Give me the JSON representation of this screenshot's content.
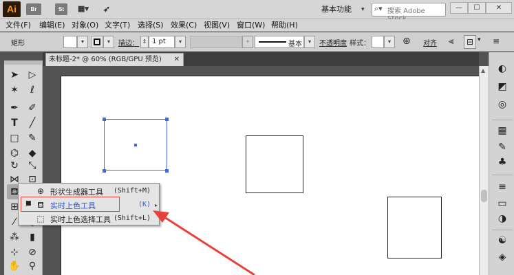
{
  "app": {
    "logo": "Ai",
    "bridge": "Br",
    "stock": "St",
    "workspace": "基本功能",
    "search_placeholder": "搜索 Adobe Stock",
    "minimize": "—",
    "maximize": "☐",
    "close": "✕"
  },
  "menu": [
    "文件(F)",
    "编辑(E)",
    "对象(O)",
    "文字(T)",
    "选择(S)",
    "效果(C)",
    "视图(V)",
    "窗口(W)",
    "帮助(H)"
  ],
  "control": {
    "object_type": "矩形",
    "stroke_label": "描边：",
    "stroke_value": "1 pt",
    "brush_label": "基本",
    "opacity_label": "不透明度",
    "style_label": "样式：",
    "align_label": "对齐"
  },
  "document": {
    "tab_title": "未标题-2* @ 60% (RGB/GPU 预览)",
    "close": "✕"
  },
  "flyout": {
    "items": [
      {
        "mark": "",
        "label": "形状生成器工具",
        "shortcut": "(Shift+M)",
        "icon": "shape-builder-icon"
      },
      {
        "mark": "■",
        "label": "实时上色工具",
        "shortcut": "(K)",
        "icon": "live-paint-bucket-icon"
      },
      {
        "mark": "",
        "label": "实时上色选择工具",
        "shortcut": "(Shift+L)",
        "icon": "live-paint-selection-icon"
      }
    ]
  },
  "colors": {
    "selection": "#4169d9",
    "highlight_text": "#3457cc",
    "annotation_red": "#e8403a"
  }
}
